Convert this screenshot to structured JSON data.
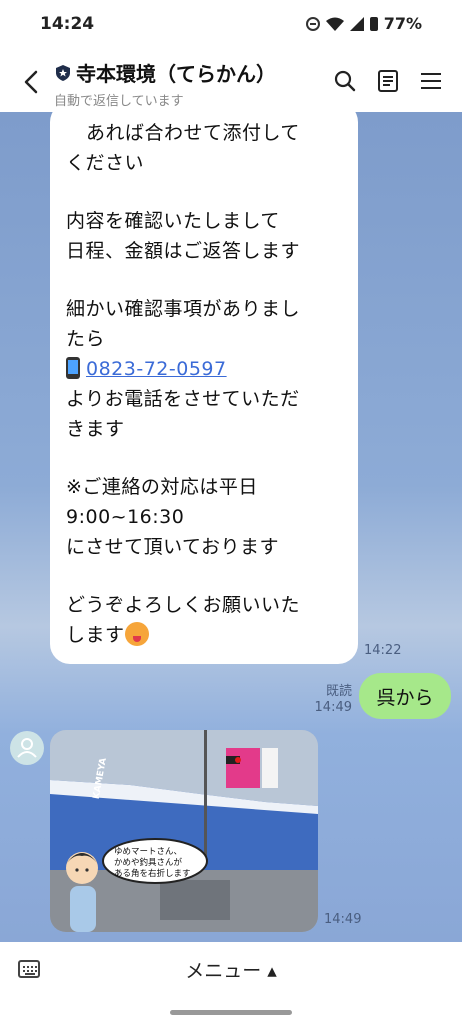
{
  "status_bar": {
    "time": "14:24",
    "battery": "77%"
  },
  "header": {
    "title": "寺本環境（てらかん）",
    "subtitle": "自動で返信しています"
  },
  "messages": {
    "incoming_text": [
      "あれば合わせて添付して",
      "ください",
      "",
      "内容を確認いたしまして",
      "日程、金額はご返答します",
      "",
      "細かい確認事項がありまし",
      "たら",
      "0823-72-0597",
      "よりお電話をさせていただ",
      "きます",
      "",
      "※ご連絡の対応は平日",
      "9:00~16:30",
      "にさせて頂いております",
      "",
      "どうぞよろしくお願いいた",
      "します"
    ],
    "incoming_time": "14:22",
    "outgoing_text": "呉から",
    "outgoing_status": "既読",
    "outgoing_time": "14:49",
    "image_time": "14:49",
    "image_caption": [
      "ゆめマートさん、",
      "かめや釣具さんが",
      "ある角を右折します"
    ],
    "image_sign": "KAMEYA"
  },
  "bottom_bar": {
    "menu_label": "メニュー ▴"
  },
  "colors": {
    "chat_bg": "#8aa4cc",
    "outgoing_bubble": "#a6e88a",
    "link": "#3b6bd7"
  }
}
